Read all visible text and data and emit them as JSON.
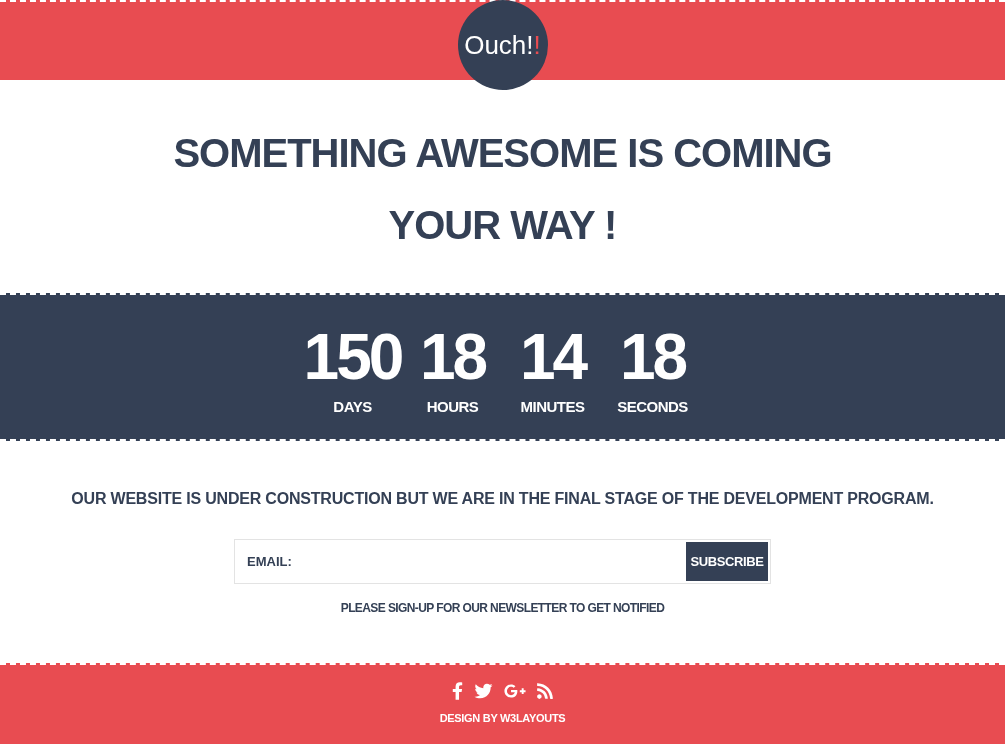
{
  "header": {
    "logo": {
      "text": "Ouch!",
      "accent": "!"
    }
  },
  "headline": "SOMETHING AWESOME IS COMING YOUR WAY !",
  "countdown": [
    {
      "value": "150",
      "unit": "DAYS"
    },
    {
      "value": "18",
      "unit": "HOURS"
    },
    {
      "value": "14",
      "unit": "MINUTES"
    },
    {
      "value": "18",
      "unit": "SECONDS"
    }
  ],
  "message": "OUR WEBSITE IS UNDER CONSTRUCTION BUT WE ARE IN THE FINAL STAGE OF THE DEVELOPMENT PROGRAM.",
  "subscribe_form": {
    "placeholder": "EMAIL:",
    "button": "SUBSCRIBE",
    "note": "PLEASE SIGN-UP FOR OUR NEWSLETTER TO GET NOTIFIED"
  },
  "footer": {
    "credit": "DESIGN BY W3LAYOUTS"
  }
}
